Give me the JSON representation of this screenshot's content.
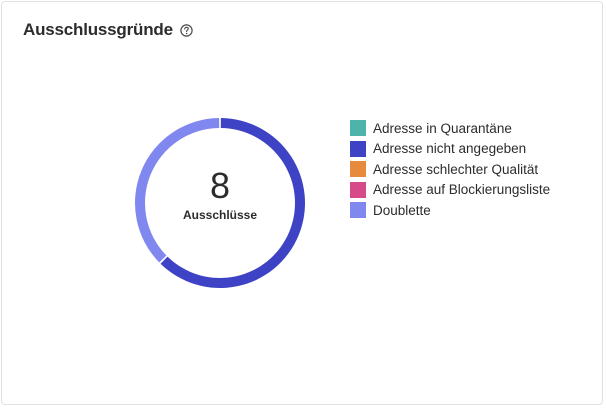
{
  "header": {
    "title": "Ausschlussgründe"
  },
  "icons": {
    "help": "help-circle-icon"
  },
  "chart_data": {
    "type": "pie",
    "center_value": "8",
    "center_label": "Ausschlüsse",
    "categories": [
      "Adresse in Quarantäne",
      "Adresse nicht angegeben",
      "Adresse schlechter Qualität",
      "Adresse auf Blockierungsliste",
      "Doublette"
    ],
    "values": [
      0,
      5,
      0,
      0,
      3
    ],
    "colors": [
      "#4db3ab",
      "#3d43c4",
      "#e68a3c",
      "#d64a8a",
      "#8088f0"
    ],
    "legend_position": "right",
    "start_angle_deg": 0
  }
}
